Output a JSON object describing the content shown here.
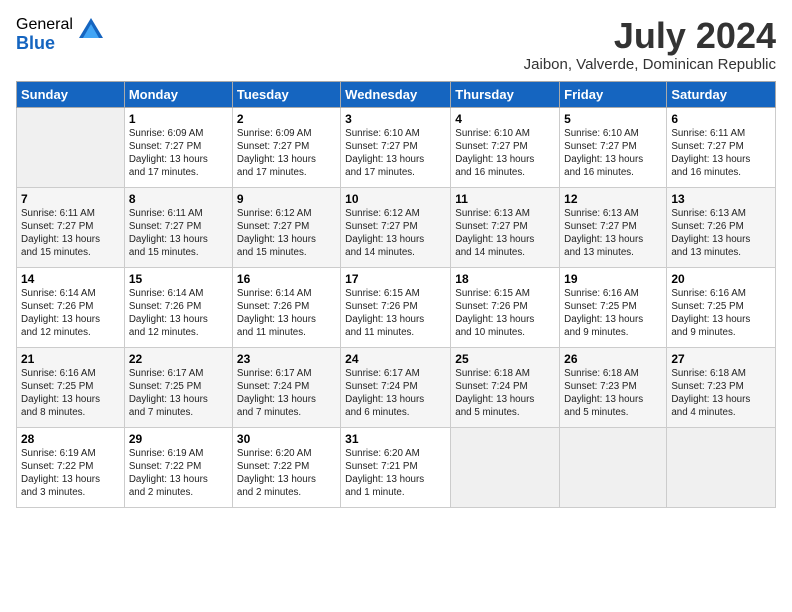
{
  "header": {
    "logo_general": "General",
    "logo_blue": "Blue",
    "month_year": "July 2024",
    "location": "Jaibon, Valverde, Dominican Republic"
  },
  "days_of_week": [
    "Sunday",
    "Monday",
    "Tuesday",
    "Wednesday",
    "Thursday",
    "Friday",
    "Saturday"
  ],
  "weeks": [
    [
      {
        "day": "",
        "sunrise": "",
        "sunset": "",
        "daylight": ""
      },
      {
        "day": "1",
        "sunrise": "6:09 AM",
        "sunset": "7:27 PM",
        "daylight": "13 hours and 17 minutes."
      },
      {
        "day": "2",
        "sunrise": "6:09 AM",
        "sunset": "7:27 PM",
        "daylight": "13 hours and 17 minutes."
      },
      {
        "day": "3",
        "sunrise": "6:10 AM",
        "sunset": "7:27 PM",
        "daylight": "13 hours and 17 minutes."
      },
      {
        "day": "4",
        "sunrise": "6:10 AM",
        "sunset": "7:27 PM",
        "daylight": "13 hours and 16 minutes."
      },
      {
        "day": "5",
        "sunrise": "6:10 AM",
        "sunset": "7:27 PM",
        "daylight": "13 hours and 16 minutes."
      },
      {
        "day": "6",
        "sunrise": "6:11 AM",
        "sunset": "7:27 PM",
        "daylight": "13 hours and 16 minutes."
      }
    ],
    [
      {
        "day": "7",
        "sunrise": "6:11 AM",
        "sunset": "7:27 PM",
        "daylight": "13 hours and 15 minutes."
      },
      {
        "day": "8",
        "sunrise": "6:11 AM",
        "sunset": "7:27 PM",
        "daylight": "13 hours and 15 minutes."
      },
      {
        "day": "9",
        "sunrise": "6:12 AM",
        "sunset": "7:27 PM",
        "daylight": "13 hours and 15 minutes."
      },
      {
        "day": "10",
        "sunrise": "6:12 AM",
        "sunset": "7:27 PM",
        "daylight": "13 hours and 14 minutes."
      },
      {
        "day": "11",
        "sunrise": "6:13 AM",
        "sunset": "7:27 PM",
        "daylight": "13 hours and 14 minutes."
      },
      {
        "day": "12",
        "sunrise": "6:13 AM",
        "sunset": "7:27 PM",
        "daylight": "13 hours and 13 minutes."
      },
      {
        "day": "13",
        "sunrise": "6:13 AM",
        "sunset": "7:26 PM",
        "daylight": "13 hours and 13 minutes."
      }
    ],
    [
      {
        "day": "14",
        "sunrise": "6:14 AM",
        "sunset": "7:26 PM",
        "daylight": "13 hours and 12 minutes."
      },
      {
        "day": "15",
        "sunrise": "6:14 AM",
        "sunset": "7:26 PM",
        "daylight": "13 hours and 12 minutes."
      },
      {
        "day": "16",
        "sunrise": "6:14 AM",
        "sunset": "7:26 PM",
        "daylight": "13 hours and 11 minutes."
      },
      {
        "day": "17",
        "sunrise": "6:15 AM",
        "sunset": "7:26 PM",
        "daylight": "13 hours and 11 minutes."
      },
      {
        "day": "18",
        "sunrise": "6:15 AM",
        "sunset": "7:26 PM",
        "daylight": "13 hours and 10 minutes."
      },
      {
        "day": "19",
        "sunrise": "6:16 AM",
        "sunset": "7:25 PM",
        "daylight": "13 hours and 9 minutes."
      },
      {
        "day": "20",
        "sunrise": "6:16 AM",
        "sunset": "7:25 PM",
        "daylight": "13 hours and 9 minutes."
      }
    ],
    [
      {
        "day": "21",
        "sunrise": "6:16 AM",
        "sunset": "7:25 PM",
        "daylight": "13 hours and 8 minutes."
      },
      {
        "day": "22",
        "sunrise": "6:17 AM",
        "sunset": "7:25 PM",
        "daylight": "13 hours and 7 minutes."
      },
      {
        "day": "23",
        "sunrise": "6:17 AM",
        "sunset": "7:24 PM",
        "daylight": "13 hours and 7 minutes."
      },
      {
        "day": "24",
        "sunrise": "6:17 AM",
        "sunset": "7:24 PM",
        "daylight": "13 hours and 6 minutes."
      },
      {
        "day": "25",
        "sunrise": "6:18 AM",
        "sunset": "7:24 PM",
        "daylight": "13 hours and 5 minutes."
      },
      {
        "day": "26",
        "sunrise": "6:18 AM",
        "sunset": "7:23 PM",
        "daylight": "13 hours and 5 minutes."
      },
      {
        "day": "27",
        "sunrise": "6:18 AM",
        "sunset": "7:23 PM",
        "daylight": "13 hours and 4 minutes."
      }
    ],
    [
      {
        "day": "28",
        "sunrise": "6:19 AM",
        "sunset": "7:22 PM",
        "daylight": "13 hours and 3 minutes."
      },
      {
        "day": "29",
        "sunrise": "6:19 AM",
        "sunset": "7:22 PM",
        "daylight": "13 hours and 2 minutes."
      },
      {
        "day": "30",
        "sunrise": "6:20 AM",
        "sunset": "7:22 PM",
        "daylight": "13 hours and 2 minutes."
      },
      {
        "day": "31",
        "sunrise": "6:20 AM",
        "sunset": "7:21 PM",
        "daylight": "13 hours and 1 minute."
      },
      {
        "day": "",
        "sunrise": "",
        "sunset": "",
        "daylight": ""
      },
      {
        "day": "",
        "sunrise": "",
        "sunset": "",
        "daylight": ""
      },
      {
        "day": "",
        "sunrise": "",
        "sunset": "",
        "daylight": ""
      }
    ]
  ]
}
